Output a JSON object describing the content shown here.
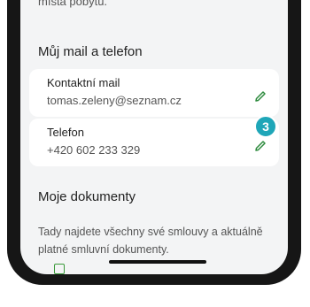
{
  "top_partial_text": "místa pobytu.",
  "contact_section": {
    "title": "Můj mail a telefon",
    "email": {
      "label": "Kontaktní mail",
      "value": "tomas.zeleny@seznam.cz",
      "edit_icon": "pencil-icon"
    },
    "phone": {
      "label": "Telefon",
      "value": "+420 602 233 329",
      "edit_icon": "pencil-icon"
    }
  },
  "tutorial_badge": {
    "number": "3",
    "color": "#1fa6b8"
  },
  "documents_section": {
    "title": "Moje dokumenty",
    "description": "Tady najdete všechny své smlouvy a aktuálně platné smluvní dokumenty."
  },
  "colors": {
    "accent": "#2e8b3e",
    "badge": "#1fa6b8",
    "background": "#f3f4f5"
  }
}
